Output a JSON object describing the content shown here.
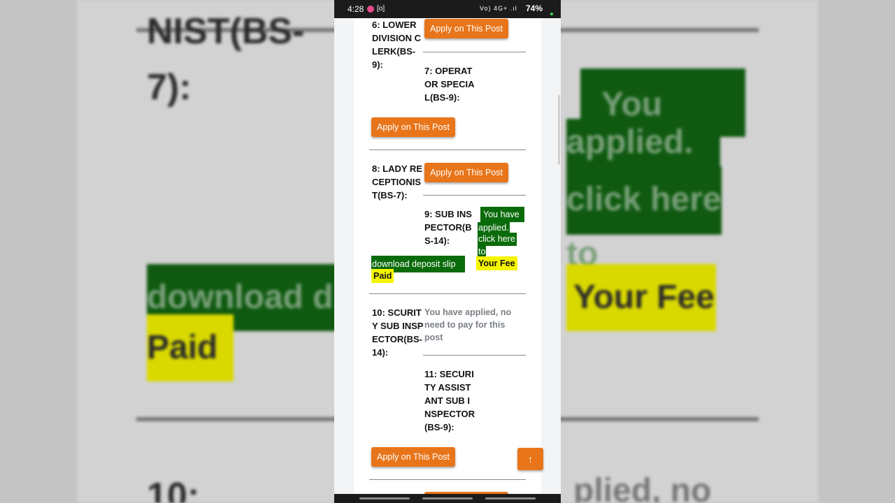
{
  "status": {
    "time": "4:28",
    "screen_icon": "[o]",
    "icons": "Vo) 4G+ .ıl",
    "battery": "74%"
  },
  "background": {
    "text_a": "NIST(BS-",
    "text_b": "7):",
    "green_1": "You have",
    "green_2": "applied.",
    "green_3": "click here",
    "green_4": "to",
    "green_5": "download d",
    "yellow_1": "Your Fee",
    "yellow_2": "Paid",
    "text_c": "10:",
    "gray_1": "plied, no"
  },
  "posts": {
    "p6": {
      "title": "6: LOWER DIVISION CLERK(BS-9):"
    },
    "p7": {
      "title": "7: OPERATOR SPECIAL(BS-9):"
    },
    "p8": {
      "title": "8: LADY RECEPTIONIST(BS-7):"
    },
    "p9": {
      "title": "9: SUB INSPECTOR(BS-14):"
    },
    "p10": {
      "title": "10: SCURITY SUB INSPECTOR(BS-14):"
    },
    "p11": {
      "title": "11: SECURITY ASSISTANT SUB INSPECTOR(BS-9):"
    }
  },
  "apply_label": "Apply on This Post",
  "applied_box": {
    "line1": "You have",
    "line2": "applied.",
    "line3": "click here",
    "line4": "to",
    "line5": "download deposit slip",
    "fee1": "Your Fee",
    "fee2": "Paid"
  },
  "applied_note": "You have applied, no need to pay for this post",
  "to_top_icon": "↑",
  "colors": {
    "apply_button": "#e8751a",
    "applied_green": "#0a6b0a",
    "fee_yellow": "#f5f500"
  }
}
